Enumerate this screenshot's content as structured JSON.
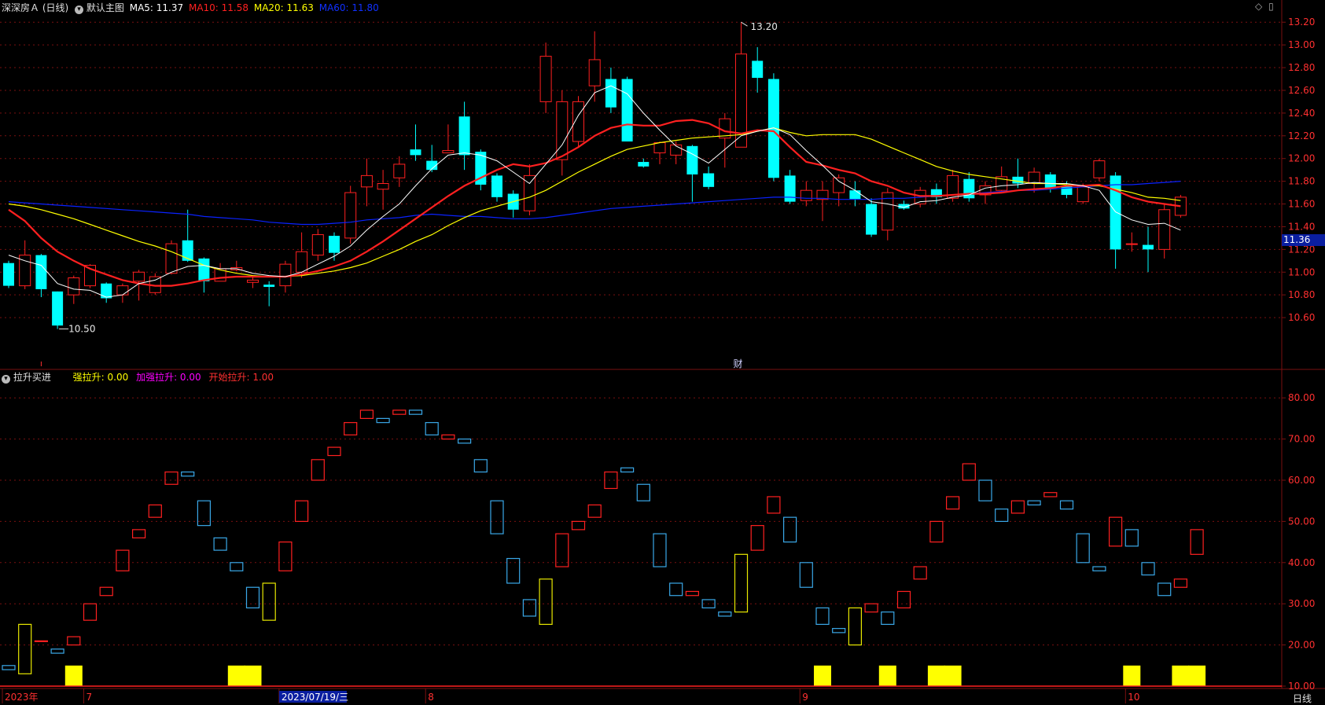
{
  "colors": {
    "up": "#ff2020",
    "down": "#00ffff",
    "ma5": "#ffffff",
    "ma10": "#ff2020",
    "ma20": "#ffff00",
    "ma60": "#0a22ff",
    "grid": "#7a1010",
    "axis_text": "#ff3030",
    "indicator_up": "#ff2020",
    "indicator_down": "#3aa8e8",
    "indicator_special": "#e8e800",
    "strong_bar": "#ffff00",
    "start_bar": "#ff1010"
  },
  "header": {
    "stock_name": "深深房Ａ",
    "period": "(日线)",
    "main_chart_label": "默认主图",
    "ma5_label": "MA5: 11.37",
    "ma10_label": "MA10: 11.58",
    "ma20_label": "MA20: 11.63",
    "ma60_label": "MA60: 11.80"
  },
  "indicator_header": {
    "name": "拉升买进",
    "strong_label": "强拉升: 0.00",
    "extra_strong_label": "加强拉升: 0.00",
    "start_label": "开始拉升: 1.00"
  },
  "right_icons": {
    "diamond_icon": "◇",
    "window_icon": "▯"
  },
  "current_price_tag": "11.36",
  "bottom_period_label": "日线",
  "chart_data": [
    {
      "type": "candlestick",
      "title": "深深房Ａ (日线)",
      "ylim": [
        10.4,
        13.25
      ],
      "yticks": [
        "13.20",
        "13.00",
        "12.80",
        "12.60",
        "12.40",
        "12.20",
        "12.00",
        "11.80",
        "11.60",
        "11.40",
        "11.20",
        "11.00",
        "10.80",
        "10.60"
      ],
      "annotations": {
        "high_label": "13.20",
        "low_label": "10.50",
        "event_marker": "财"
      },
      "x_labels": [
        "2023年",
        "7",
        "2023/07/19/三",
        "8",
        "9",
        "10"
      ],
      "x_label_index": [
        0,
        5,
        17,
        26,
        49,
        69
      ],
      "candles": [
        [
          11.08,
          10.88,
          11.1,
          10.86
        ],
        [
          10.88,
          11.15,
          11.28,
          10.85
        ],
        [
          11.15,
          10.85,
          11.16,
          10.78
        ],
        [
          10.83,
          10.53,
          10.83,
          10.5
        ],
        [
          10.8,
          10.95,
          10.97,
          10.72
        ],
        [
          10.88,
          11.06,
          11.07,
          10.86
        ],
        [
          10.9,
          10.77,
          10.91,
          10.73
        ],
        [
          10.8,
          10.88,
          10.9,
          10.73
        ],
        [
          10.92,
          11.0,
          11.02,
          10.75
        ],
        [
          10.82,
          10.96,
          10.99,
          10.8
        ],
        [
          10.99,
          11.25,
          11.28,
          10.98
        ],
        [
          11.28,
          11.1,
          11.55,
          11.09
        ],
        [
          11.12,
          10.92,
          11.13,
          10.82
        ],
        [
          10.92,
          11.03,
          11.08,
          10.92
        ],
        [
          11.02,
          11.04,
          11.1,
          11.01
        ],
        [
          10.91,
          10.93,
          10.96,
          10.86
        ],
        [
          10.89,
          10.87,
          10.92,
          10.7
        ],
        [
          10.88,
          11.07,
          11.1,
          10.82
        ],
        [
          11.0,
          11.18,
          11.35,
          10.95
        ],
        [
          11.15,
          11.33,
          11.38,
          11.1
        ],
        [
          11.32,
          11.17,
          11.35,
          11.1
        ],
        [
          11.3,
          11.7,
          11.76,
          11.25
        ],
        [
          11.75,
          11.85,
          12.0,
          11.58
        ],
        [
          11.73,
          11.78,
          11.9,
          11.55
        ],
        [
          11.83,
          11.95,
          12.02,
          11.75
        ],
        [
          12.08,
          12.03,
          12.3,
          11.98
        ],
        [
          11.98,
          11.9,
          12.12,
          11.88
        ],
        [
          12.05,
          12.07,
          12.3,
          12.06
        ],
        [
          12.37,
          12.03,
          12.5,
          11.9
        ],
        [
          12.06,
          11.77,
          12.08,
          11.72
        ],
        [
          11.85,
          11.66,
          11.87,
          11.62
        ],
        [
          11.69,
          11.55,
          11.72,
          11.48
        ],
        [
          11.54,
          11.85,
          11.95,
          11.5
        ],
        [
          12.5,
          12.9,
          13.02,
          12.4
        ],
        [
          11.99,
          12.5,
          12.6,
          11.85
        ],
        [
          12.15,
          12.5,
          12.55,
          12.1
        ],
        [
          12.64,
          12.87,
          13.12,
          12.5
        ],
        [
          12.7,
          12.45,
          12.8,
          12.4
        ],
        [
          12.7,
          12.15,
          12.72,
          12.15
        ],
        [
          11.97,
          11.93,
          12.0,
          11.92
        ],
        [
          12.05,
          12.14,
          12.15,
          11.95
        ],
        [
          12.03,
          12.12,
          12.15,
          11.95
        ],
        [
          12.11,
          11.86,
          12.12,
          11.62
        ],
        [
          11.87,
          11.75,
          11.93,
          11.73
        ],
        [
          12.18,
          12.35,
          12.4,
          11.92
        ],
        [
          12.1,
          12.92,
          13.2,
          12.1
        ],
        [
          12.86,
          12.71,
          12.98,
          12.58
        ],
        [
          12.7,
          11.83,
          12.75,
          11.8
        ],
        [
          11.85,
          11.62,
          11.9,
          11.6
        ],
        [
          11.63,
          11.72,
          11.8,
          11.58
        ],
        [
          11.64,
          11.72,
          11.8,
          11.45
        ],
        [
          11.7,
          11.83,
          11.86,
          11.58
        ],
        [
          11.72,
          11.64,
          11.8,
          11.58
        ],
        [
          11.6,
          11.33,
          11.65,
          11.31
        ],
        [
          11.37,
          11.7,
          11.74,
          11.28
        ],
        [
          11.6,
          11.56,
          11.63,
          11.55
        ],
        [
          11.6,
          11.72,
          11.75,
          11.57
        ],
        [
          11.73,
          11.66,
          11.78,
          11.6
        ],
        [
          11.65,
          11.85,
          11.9,
          11.62
        ],
        [
          11.82,
          11.65,
          11.88,
          11.62
        ],
        [
          11.68,
          11.76,
          11.8,
          11.6
        ],
        [
          11.72,
          11.84,
          11.93,
          11.7
        ],
        [
          11.84,
          11.78,
          12.0,
          11.74
        ],
        [
          11.78,
          11.88,
          11.92,
          11.7
        ],
        [
          11.86,
          11.74,
          11.88,
          11.7
        ],
        [
          11.76,
          11.68,
          11.8,
          11.65
        ],
        [
          11.62,
          11.75,
          11.78,
          11.6
        ],
        [
          11.83,
          11.98,
          12.0,
          11.8
        ],
        [
          11.85,
          11.2,
          11.88,
          11.03
        ],
        [
          11.25,
          11.25,
          11.35,
          11.18
        ],
        [
          11.24,
          11.2,
          11.4,
          11.0
        ],
        [
          11.2,
          11.55,
          11.6,
          11.12
        ],
        [
          11.5,
          11.66,
          11.68,
          11.48
        ]
      ],
      "ma5": [
        11.15,
        11.1,
        11.06,
        10.9,
        10.85,
        10.84,
        10.78,
        10.8,
        10.9,
        10.93,
        11.0,
        11.05,
        11.06,
        11.03,
        11.03,
        10.99,
        10.97,
        10.96,
        11.0,
        11.07,
        11.14,
        11.23,
        11.37,
        11.49,
        11.6,
        11.76,
        11.91,
        12.03,
        12.05,
        12.03,
        11.98,
        11.88,
        11.78,
        11.95,
        12.12,
        12.38,
        12.58,
        12.64,
        12.57,
        12.4,
        12.25,
        12.11,
        12.04,
        11.96,
        12.08,
        12.2,
        12.24,
        12.27,
        12.21,
        12.07,
        11.94,
        11.8,
        11.72,
        11.62,
        11.6,
        11.57,
        11.62,
        11.63,
        11.66,
        11.68,
        11.74,
        11.76,
        11.77,
        11.79,
        11.78,
        11.78,
        11.76,
        11.72,
        11.53,
        11.46,
        11.42,
        11.43,
        11.37
      ],
      "ma10": [
        11.55,
        11.45,
        11.3,
        11.18,
        11.1,
        11.03,
        10.98,
        10.93,
        10.9,
        10.88,
        10.88,
        10.9,
        10.93,
        10.95,
        10.96,
        10.96,
        10.96,
        10.96,
        10.98,
        11.01,
        11.05,
        11.1,
        11.18,
        11.27,
        11.37,
        11.47,
        11.57,
        11.67,
        11.76,
        11.83,
        11.9,
        11.95,
        11.93,
        11.96,
        12.02,
        12.1,
        12.2,
        12.27,
        12.3,
        12.29,
        12.29,
        12.33,
        12.34,
        12.31,
        12.24,
        12.22,
        12.25,
        12.24,
        12.1,
        11.97,
        11.94,
        11.9,
        11.87,
        11.8,
        11.76,
        11.7,
        11.67,
        11.67,
        11.68,
        11.69,
        11.69,
        11.7,
        11.72,
        11.73,
        11.74,
        11.76,
        11.76,
        11.77,
        11.72,
        11.66,
        11.62,
        11.6,
        11.58
      ],
      "ma20": [
        11.6,
        11.58,
        11.55,
        11.51,
        11.47,
        11.42,
        11.37,
        11.32,
        11.27,
        11.23,
        11.18,
        11.12,
        11.06,
        11.02,
        10.99,
        10.97,
        10.96,
        10.96,
        10.97,
        10.99,
        11.01,
        11.04,
        11.08,
        11.14,
        11.2,
        11.27,
        11.33,
        11.41,
        11.48,
        11.54,
        11.58,
        11.62,
        11.66,
        11.72,
        11.8,
        11.88,
        11.95,
        12.02,
        12.08,
        12.11,
        12.14,
        12.16,
        12.18,
        12.19,
        12.2,
        12.21,
        12.24,
        12.27,
        12.23,
        12.2,
        12.21,
        12.21,
        12.21,
        12.17,
        12.11,
        12.05,
        11.99,
        11.93,
        11.89,
        11.86,
        11.84,
        11.82,
        11.8,
        11.78,
        11.78,
        11.77,
        11.76,
        11.76,
        11.73,
        11.7,
        11.66,
        11.65,
        11.63
      ],
      "ma60": [
        11.62,
        11.61,
        11.6,
        11.59,
        11.58,
        11.57,
        11.56,
        11.55,
        11.54,
        11.53,
        11.52,
        11.51,
        11.49,
        11.48,
        11.47,
        11.46,
        11.44,
        11.43,
        11.42,
        11.42,
        11.43,
        11.44,
        11.46,
        11.47,
        11.48,
        11.5,
        11.51,
        11.5,
        11.49,
        11.49,
        11.48,
        11.47,
        11.47,
        11.48,
        11.5,
        11.52,
        11.54,
        11.56,
        11.57,
        11.58,
        11.59,
        11.6,
        11.61,
        11.62,
        11.63,
        11.64,
        11.65,
        11.66,
        11.66,
        11.65,
        11.65,
        11.64,
        11.64,
        11.64,
        11.65,
        11.65,
        11.66,
        11.67,
        11.68,
        11.69,
        11.7,
        11.71,
        11.72,
        11.72,
        11.73,
        11.74,
        11.75,
        11.76,
        11.77,
        11.77,
        11.78,
        11.79,
        11.8
      ]
    },
    {
      "type": "candlestick",
      "title": "拉升买进",
      "ylim": [
        10,
        85
      ],
      "yticks": [
        "80.00",
        "70.00",
        "60.00",
        "50.00",
        "40.00",
        "30.00",
        "20.00",
        "10.00"
      ],
      "boxes": [
        [
          14,
          15,
          "d"
        ],
        [
          13,
          25,
          "s"
        ],
        [
          21,
          21,
          "u"
        ],
        [
          18,
          19,
          "d"
        ],
        [
          20,
          22,
          "u"
        ],
        [
          26,
          30,
          "u"
        ],
        [
          32,
          34,
          "u"
        ],
        [
          38,
          43,
          "u"
        ],
        [
          46,
          48,
          "u"
        ],
        [
          51,
          54,
          "u"
        ],
        [
          59,
          62,
          "u"
        ],
        [
          61,
          62,
          "d"
        ],
        [
          49,
          55,
          "d"
        ],
        [
          43,
          46,
          "d"
        ],
        [
          38,
          40,
          "d"
        ],
        [
          29,
          34,
          "d"
        ],
        [
          26,
          35,
          "s"
        ],
        [
          38,
          45,
          "u"
        ],
        [
          50,
          55,
          "u"
        ],
        [
          60,
          65,
          "u"
        ],
        [
          66,
          68,
          "u"
        ],
        [
          71,
          74,
          "u"
        ],
        [
          75,
          77,
          "u"
        ],
        [
          74,
          75,
          "d"
        ],
        [
          76,
          77,
          "u"
        ],
        [
          76,
          77,
          "d"
        ],
        [
          71,
          74,
          "d"
        ],
        [
          70,
          71,
          "u"
        ],
        [
          69,
          70,
          "d"
        ],
        [
          62,
          65,
          "d"
        ],
        [
          47,
          55,
          "d"
        ],
        [
          35,
          41,
          "d"
        ],
        [
          27,
          31,
          "d"
        ],
        [
          25,
          36,
          "s"
        ],
        [
          39,
          47,
          "u"
        ],
        [
          48,
          50,
          "u"
        ],
        [
          51,
          54,
          "u"
        ],
        [
          58,
          62,
          "u"
        ],
        [
          62,
          63,
          "d"
        ],
        [
          55,
          59,
          "d"
        ],
        [
          39,
          47,
          "d"
        ],
        [
          32,
          35,
          "d"
        ],
        [
          32,
          33,
          "u"
        ],
        [
          29,
          31,
          "d"
        ],
        [
          27,
          28,
          "d"
        ],
        [
          28,
          42,
          "s"
        ],
        [
          43,
          49,
          "u"
        ],
        [
          52,
          56,
          "u"
        ],
        [
          45,
          51,
          "d"
        ],
        [
          34,
          40,
          "d"
        ],
        [
          25,
          29,
          "d"
        ],
        [
          23,
          24,
          "d"
        ],
        [
          20,
          29,
          "s"
        ],
        [
          28,
          30,
          "u"
        ],
        [
          25,
          28,
          "d"
        ],
        [
          29,
          33,
          "u"
        ],
        [
          36,
          39,
          "u"
        ],
        [
          45,
          50,
          "u"
        ],
        [
          53,
          56,
          "u"
        ],
        [
          60,
          64,
          "u"
        ],
        [
          55,
          60,
          "d"
        ],
        [
          50,
          53,
          "d"
        ],
        [
          52,
          55,
          "u"
        ],
        [
          54,
          55,
          "d"
        ],
        [
          56,
          57,
          "u"
        ],
        [
          53,
          55,
          "d"
        ],
        [
          40,
          47,
          "d"
        ],
        [
          38,
          39,
          "d"
        ],
        [
          44,
          51,
          "u"
        ],
        [
          44,
          48,
          "d"
        ],
        [
          37,
          40,
          "d"
        ],
        [
          32,
          35,
          "d"
        ],
        [
          34,
          36,
          "u"
        ],
        [
          42,
          48,
          "u"
        ]
      ],
      "strong_bars": [
        4,
        14,
        15,
        50,
        54,
        57,
        58,
        69,
        72,
        73
      ],
      "start_bars": [
        0,
        2,
        4,
        6,
        7,
        8,
        9,
        17,
        33,
        45,
        51,
        53,
        55,
        57,
        59,
        60,
        61,
        62,
        71,
        73,
        74
      ]
    }
  ]
}
